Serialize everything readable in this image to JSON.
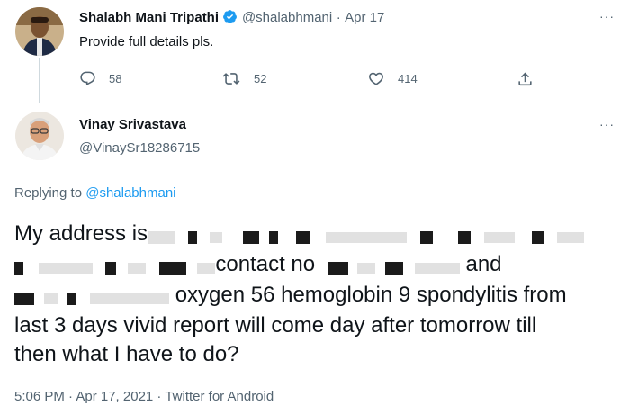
{
  "parent_tweet": {
    "display_name": "Shalabh Mani Tripathi",
    "handle": "@shalabhmani",
    "separator": "·",
    "date": "Apr 17",
    "text": "Provide full details pls.",
    "more_label": "···",
    "actions": {
      "reply_count": "58",
      "retweet_count": "52",
      "like_count": "414"
    }
  },
  "reply_tweet": {
    "display_name": "Vinay Srivastava",
    "handle": "@VinaySr18286715",
    "more_label": "···",
    "replying_prefix": "Replying to",
    "replying_mention": "@shalabhmani",
    "body_lines": {
      "line1": "My address is",
      "line2": "contact no",
      "line2b": "and",
      "line3": "oxygen 56 hemoglobin 9 spondylitis  from",
      "line4": "last 3 days vivid report will come day after tomorrow till",
      "line5": "then what I have to do?"
    },
    "timestamp": "5:06 PM · Apr 17, 2021 · Twitter for Android"
  },
  "colors": {
    "accent": "#1d9bf0",
    "secondary_text": "#536471",
    "primary_text": "#0f1419"
  }
}
